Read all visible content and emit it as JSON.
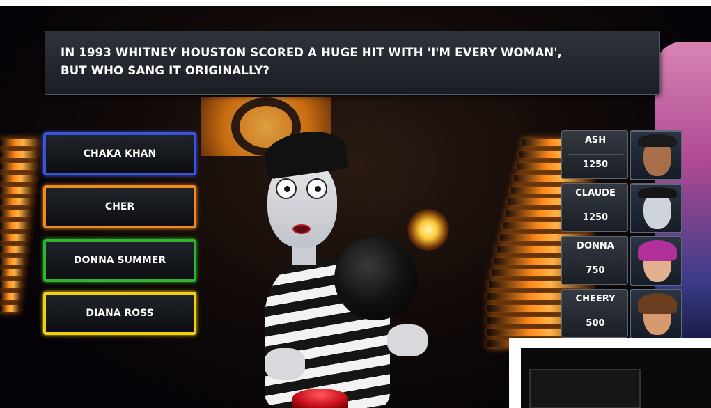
{
  "question": {
    "text": "IN 1993 WHITNEY HOUSTON SCORED A HUGE HIT WITH 'I'M EVERY WOMAN',\nBUT WHO SANG IT ORIGINALLY?"
  },
  "answers": [
    {
      "label": "CHAKA KHAN",
      "color": "#3b55d8"
    },
    {
      "label": "CHER",
      "color": "#f08a1e"
    },
    {
      "label": "DONNA SUMMER",
      "color": "#2fb331"
    },
    {
      "label": "DIANA ROSS",
      "color": "#f1cf12"
    }
  ],
  "players": [
    {
      "name": "ASH",
      "score": "1250",
      "avatar": "ash-avatar"
    },
    {
      "name": "CLAUDE",
      "score": "1250",
      "avatar": "claude-avatar"
    },
    {
      "name": "DONNA",
      "score": "750",
      "avatar": "donna-avatar"
    },
    {
      "name": "CHEERY",
      "score": "500",
      "avatar": "cheery-avatar"
    }
  ],
  "colors": {
    "stair_glow": "#ff8a1a",
    "panel_bg": "#1a1d23"
  }
}
